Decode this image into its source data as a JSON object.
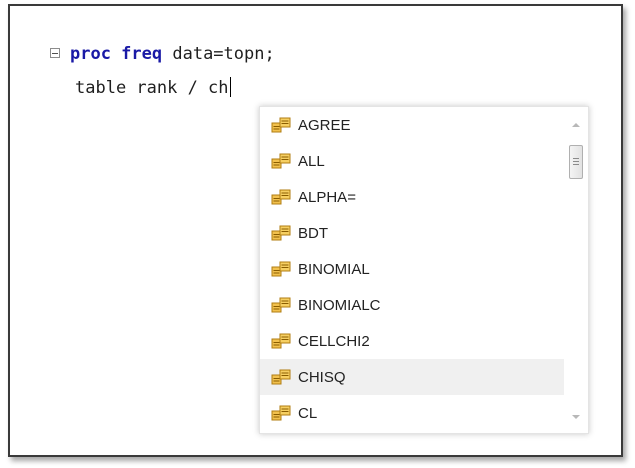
{
  "editor": {
    "line1": {
      "kw1": "proc freq",
      "rest": " data=topn;"
    },
    "line2": {
      "text": "table rank / ch"
    }
  },
  "completion": {
    "items": [
      {
        "label": "AGREE",
        "icon": "option-icon"
      },
      {
        "label": "ALL",
        "icon": "option-icon"
      },
      {
        "label": "ALPHA=",
        "icon": "option-icon"
      },
      {
        "label": "BDT",
        "icon": "option-icon"
      },
      {
        "label": "BINOMIAL",
        "icon": "option-icon"
      },
      {
        "label": "BINOMIALC",
        "icon": "option-icon"
      },
      {
        "label": "CELLCHI2",
        "icon": "option-icon"
      },
      {
        "label": "CHISQ",
        "icon": "option-icon",
        "selected": true
      },
      {
        "label": "CL",
        "icon": "option-icon"
      }
    ]
  },
  "colors": {
    "keyword": "#1a1aa6",
    "selected_row": "#f0f0f0"
  }
}
